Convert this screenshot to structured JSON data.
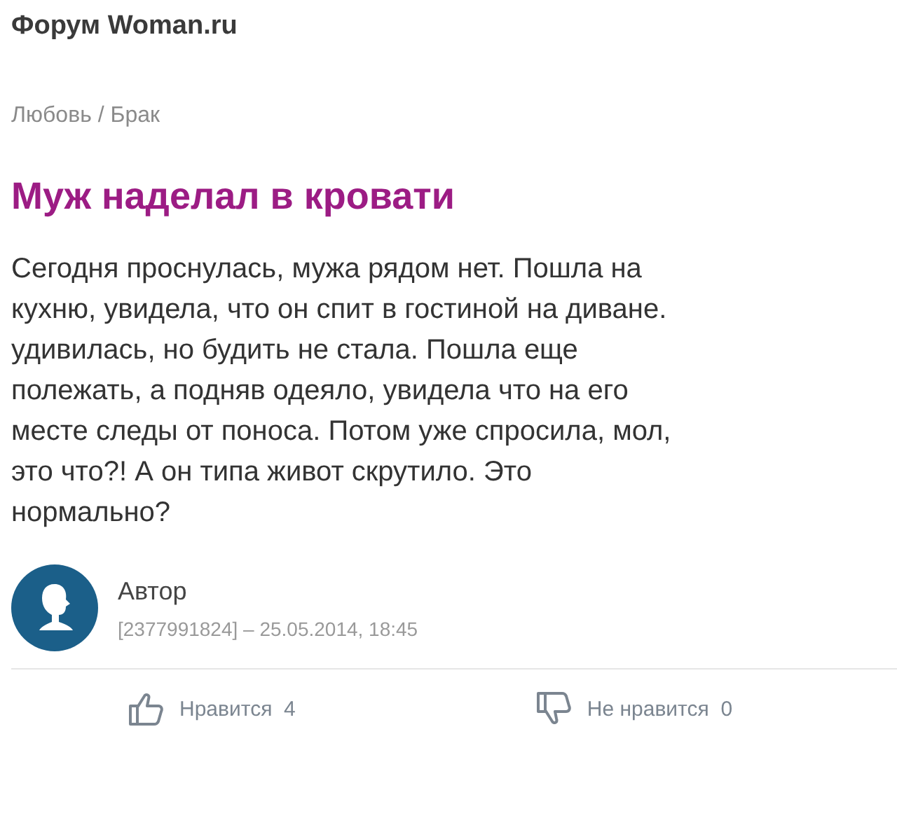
{
  "site_title": "Форум Woman.ru",
  "breadcrumb": "Любовь / Брак",
  "post": {
    "title": "Муж наделал в кровати",
    "body": "Сегодня проснулась, мужа рядом нет. Пошла на\nкухню, увидела, что он спит в гостиной на диване.\nудивилась, но будить не стала. Пошла еще\nполежать, а подняв одеяло, увидела что на его\nместе следы от поноса. Потом уже спросила, мол,\nэто что?! А он типа живот скрутило. Это\nнормально?"
  },
  "author": {
    "name": "Автор",
    "meta": "[2377991824] – 25.05.2014, 18:45"
  },
  "reactions": [
    {
      "kind": "like",
      "label": "Нравится",
      "count": "4"
    },
    {
      "kind": "dislike",
      "label": "Не нравится",
      "count": "0"
    }
  ]
}
